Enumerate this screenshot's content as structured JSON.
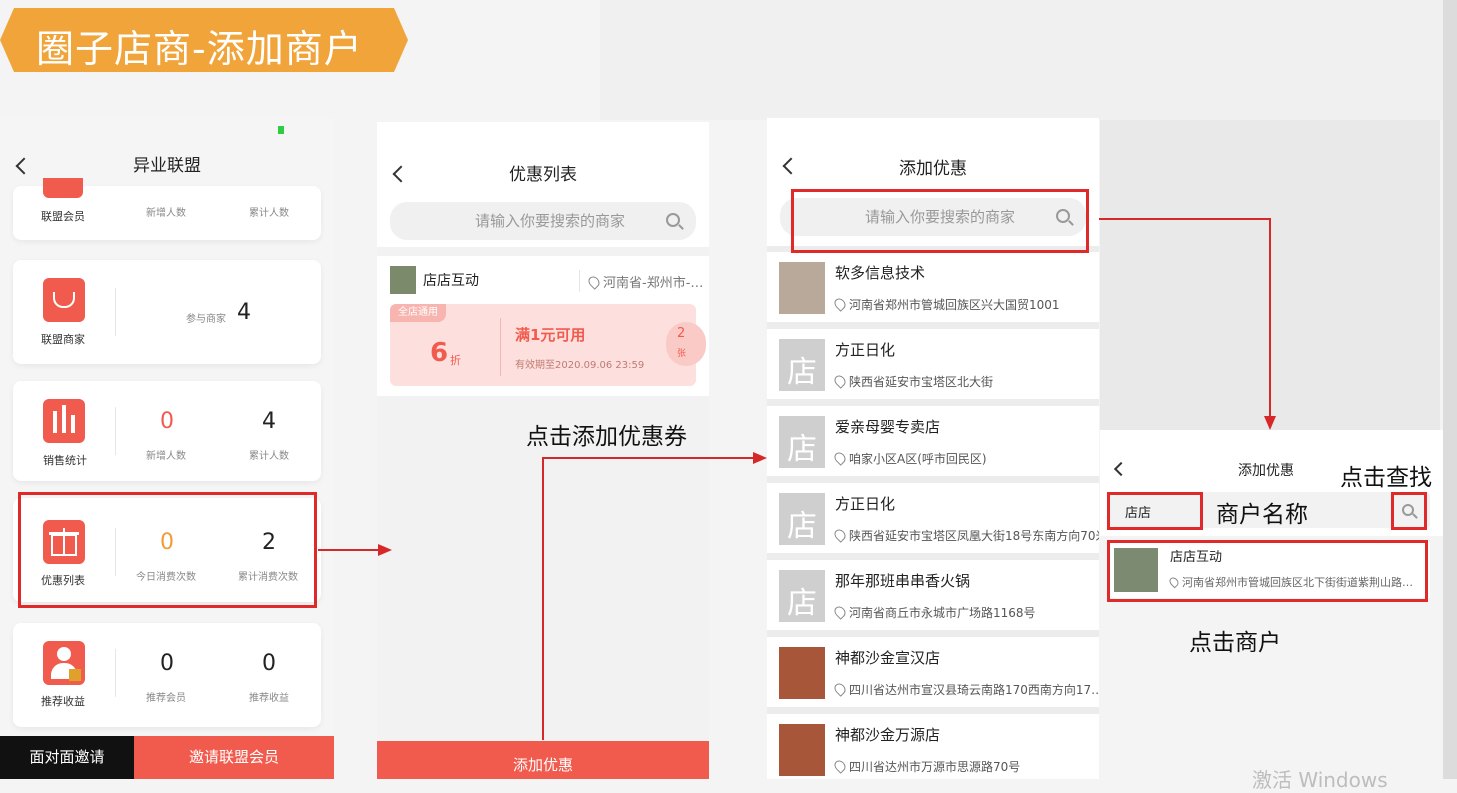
{
  "banner": {
    "title": "圈子店商-添加商户"
  },
  "screen1": {
    "title": "异业联盟",
    "rows": [
      {
        "label": "联盟会员",
        "stats": [
          {
            "value": "",
            "label": "新增人数"
          },
          {
            "value": "",
            "label": "累计人数"
          }
        ]
      },
      {
        "label": "联盟商家",
        "stats": [
          {
            "value": "4",
            "label": "参与商家"
          }
        ]
      },
      {
        "label": "销售统计",
        "stats": [
          {
            "value": "0",
            "label": "新增人数"
          },
          {
            "value": "4",
            "label": "累计人数"
          }
        ]
      },
      {
        "label": "优惠列表",
        "stats": [
          {
            "value": "0",
            "label": "今日消费次数"
          },
          {
            "value": "2",
            "label": "累计消费次数"
          }
        ]
      },
      {
        "label": "推荐收益",
        "stats": [
          {
            "value": "0",
            "label": "推荐会员"
          },
          {
            "value": "0",
            "label": "推荐收益"
          }
        ]
      }
    ],
    "btn_left": "面对面邀请",
    "btn_right": "邀请联盟会员"
  },
  "screen2": {
    "title": "优惠列表",
    "search_placeholder": "请输入你要搜索的商家",
    "shop_name": "店店互动",
    "shop_location": "河南省-郑州市-…",
    "coupon": {
      "tag": "全店通用",
      "discount": "6",
      "unit": "折",
      "condition": "满1元可用",
      "expiry": "有效期至2020.09.06 23:59",
      "count": "2",
      "count_unit": "张"
    },
    "bottom_button": "添加优惠"
  },
  "screen3": {
    "title": "添加优惠",
    "search_placeholder": "请输入你要搜索的商家",
    "merchants": [
      {
        "name": "软多信息技术",
        "address": "河南省郑州市管城回族区兴大国贸1001"
      },
      {
        "name": "方正日化",
        "address": "陕西省延安市宝塔区北大街"
      },
      {
        "name": "爱亲母婴专卖店",
        "address": "咱家小区A区(呼市回民区)"
      },
      {
        "name": "方正日化",
        "address": "陕西省延安市宝塔区凤凰大街18号东南方向70米"
      },
      {
        "name": "那年那班串串香火锅",
        "address": "河南省商丘市永城市广场路1168号"
      },
      {
        "name": "神都沙金宣汉店",
        "address": "四川省达州市宣汉县琦云南路170西南方向17…"
      },
      {
        "name": "神都沙金万源店",
        "address": "四川省达州市万源市思源路70号"
      }
    ]
  },
  "screen4": {
    "title": "添加优惠",
    "search_value": "店店",
    "result": {
      "name": "店店互动",
      "address": "河南省郑州市管城回族区北下街街道紫荆山路…"
    }
  },
  "annotations": {
    "add_coupon": "点击添加优惠券",
    "click_search": "点击查找",
    "merchant_name": "商户名称",
    "click_merchant": "点击商户"
  },
  "watermark": "激活 Windows",
  "colors": {
    "accent": "#f15b4e",
    "banner": "#f0a43a",
    "annotation_red": "#e02a2a"
  }
}
